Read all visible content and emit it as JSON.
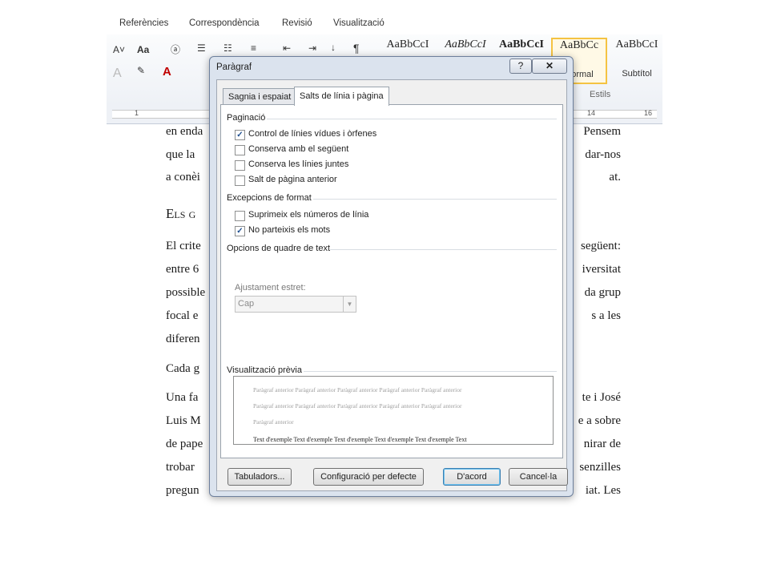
{
  "ribbon": {
    "tabs": [
      "Referències",
      "Correspondència",
      "Revisió",
      "Visualització"
    ],
    "font_size_btn": "Aa",
    "styles": [
      {
        "sample": "AaBbCcI",
        "name": ""
      },
      {
        "sample": "AaBbCcI",
        "name": ""
      },
      {
        "sample": "AaBbCcI",
        "name": ""
      },
      {
        "sample": "AaBbCc",
        "name": "Normal"
      },
      {
        "sample": "AaBbCcI",
        "name": "Subtítol"
      }
    ],
    "group_label": "Estils",
    "ruler_marks": [
      "1",
      "14",
      "16"
    ]
  },
  "document": {
    "lines": [
      {
        "left": "en enda",
        "right": "Pensem"
      },
      {
        "left": "que la",
        "right": "dar-nos"
      },
      {
        "left": "a conèi",
        "right": "at."
      },
      {
        "left": "Els g",
        "right": ""
      },
      {
        "left": "El crite",
        "right": "següent:"
      },
      {
        "left": "entre 6",
        "right": "iversitat"
      },
      {
        "left": "possible",
        "right": "da grup"
      },
      {
        "left": "focal e",
        "right": "s a les"
      },
      {
        "left": "diferen",
        "right": ""
      },
      {
        "left": "Cada g",
        "right": ""
      },
      {
        "left": "Una fa",
        "right": "te i José"
      },
      {
        "left": "Luis M",
        "right": "e a sobre"
      },
      {
        "left": "de pape",
        "right": "nirar de"
      },
      {
        "left": "trobar",
        "right": "senzilles"
      },
      {
        "left": "pregun",
        "right": "iat. Les"
      }
    ]
  },
  "dialog": {
    "title": "Paràgraf",
    "help_label": "?",
    "close_label": "✕",
    "tabs": [
      "Sagnia i espaiat",
      "Salts de línia i pàgina"
    ],
    "pagination": {
      "heading": "Paginació",
      "items": [
        {
          "label": "Control de línies vídues i òrfenes",
          "checked": true,
          "mark": "✓"
        },
        {
          "label": "Conserva amb el següent",
          "checked": false,
          "mark": ""
        },
        {
          "label": "Conserva les línies juntes",
          "checked": false,
          "mark": ""
        },
        {
          "label": "Salt de pàgina anterior",
          "checked": false,
          "mark": ""
        }
      ]
    },
    "exceptions": {
      "heading": "Excepcions de format",
      "items": [
        {
          "label": "Suprimeix els números de línia",
          "checked": false,
          "mark": ""
        },
        {
          "label": "No parteixis els mots",
          "checked": true,
          "mark": "✓"
        }
      ]
    },
    "textbox": {
      "heading": "Opcions de quadre de text",
      "wrap_label": "Ajustament estret:",
      "wrap_value": "Cap"
    },
    "preview": {
      "heading": "Visualització prèvia",
      "prev_lines": [
        "Paràgraf anterior Paràgraf anterior Paràgraf anterior Paràgraf anterior Paràgraf anterior",
        "Paràgraf anterior Paràgraf anterior Paràgraf anterior Paràgraf anterior Paràgraf anterior",
        "Paràgraf anterior"
      ],
      "sample_text": "Text d'exemple Text d'exemple Text d'exemple Text d'exemple Text d'exemple Text"
    },
    "buttons": {
      "tabs": "Tabuladors...",
      "default": "Configuració per defecte",
      "ok": "D'acord",
      "cancel": "Cancel·la"
    }
  }
}
